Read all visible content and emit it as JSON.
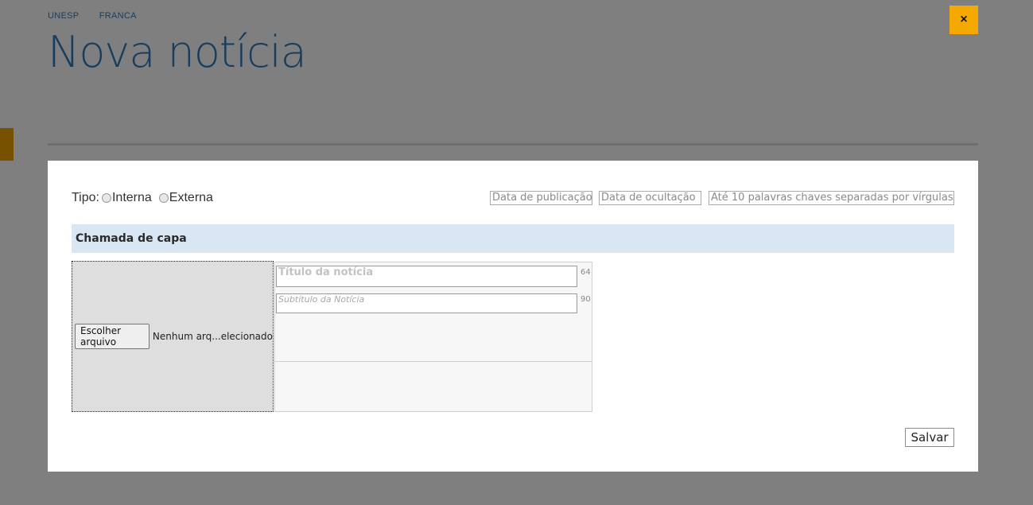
{
  "breadcrumb": [
    "UNESP",
    "FRANCA"
  ],
  "page": {
    "title": "Nova notícia"
  },
  "close_icon": "×",
  "form": {
    "tipo_label": "Tipo:",
    "tipo_options": [
      "Interna",
      "Externa"
    ],
    "publish_date_placeholder": "Data de publicação",
    "hide_date_placeholder": "Data de ocultação",
    "keywords_placeholder": "Até 10 palavras chaves separadas por vírgulas",
    "section_title": "Chamada de capa",
    "file_button_label": "Escolher arquivo",
    "file_status": "Nenhum arq...elecionado",
    "title_placeholder": "Título da notícia",
    "title_counter": "64",
    "subtitle_placeholder": "Subtítulo da Notícia",
    "subtitle_counter": "90",
    "save_label": "Salvar"
  },
  "colors": {
    "accent": "#f5a800",
    "title_blue": "#2f7bbf",
    "section_bg": "#d9e6f4"
  }
}
